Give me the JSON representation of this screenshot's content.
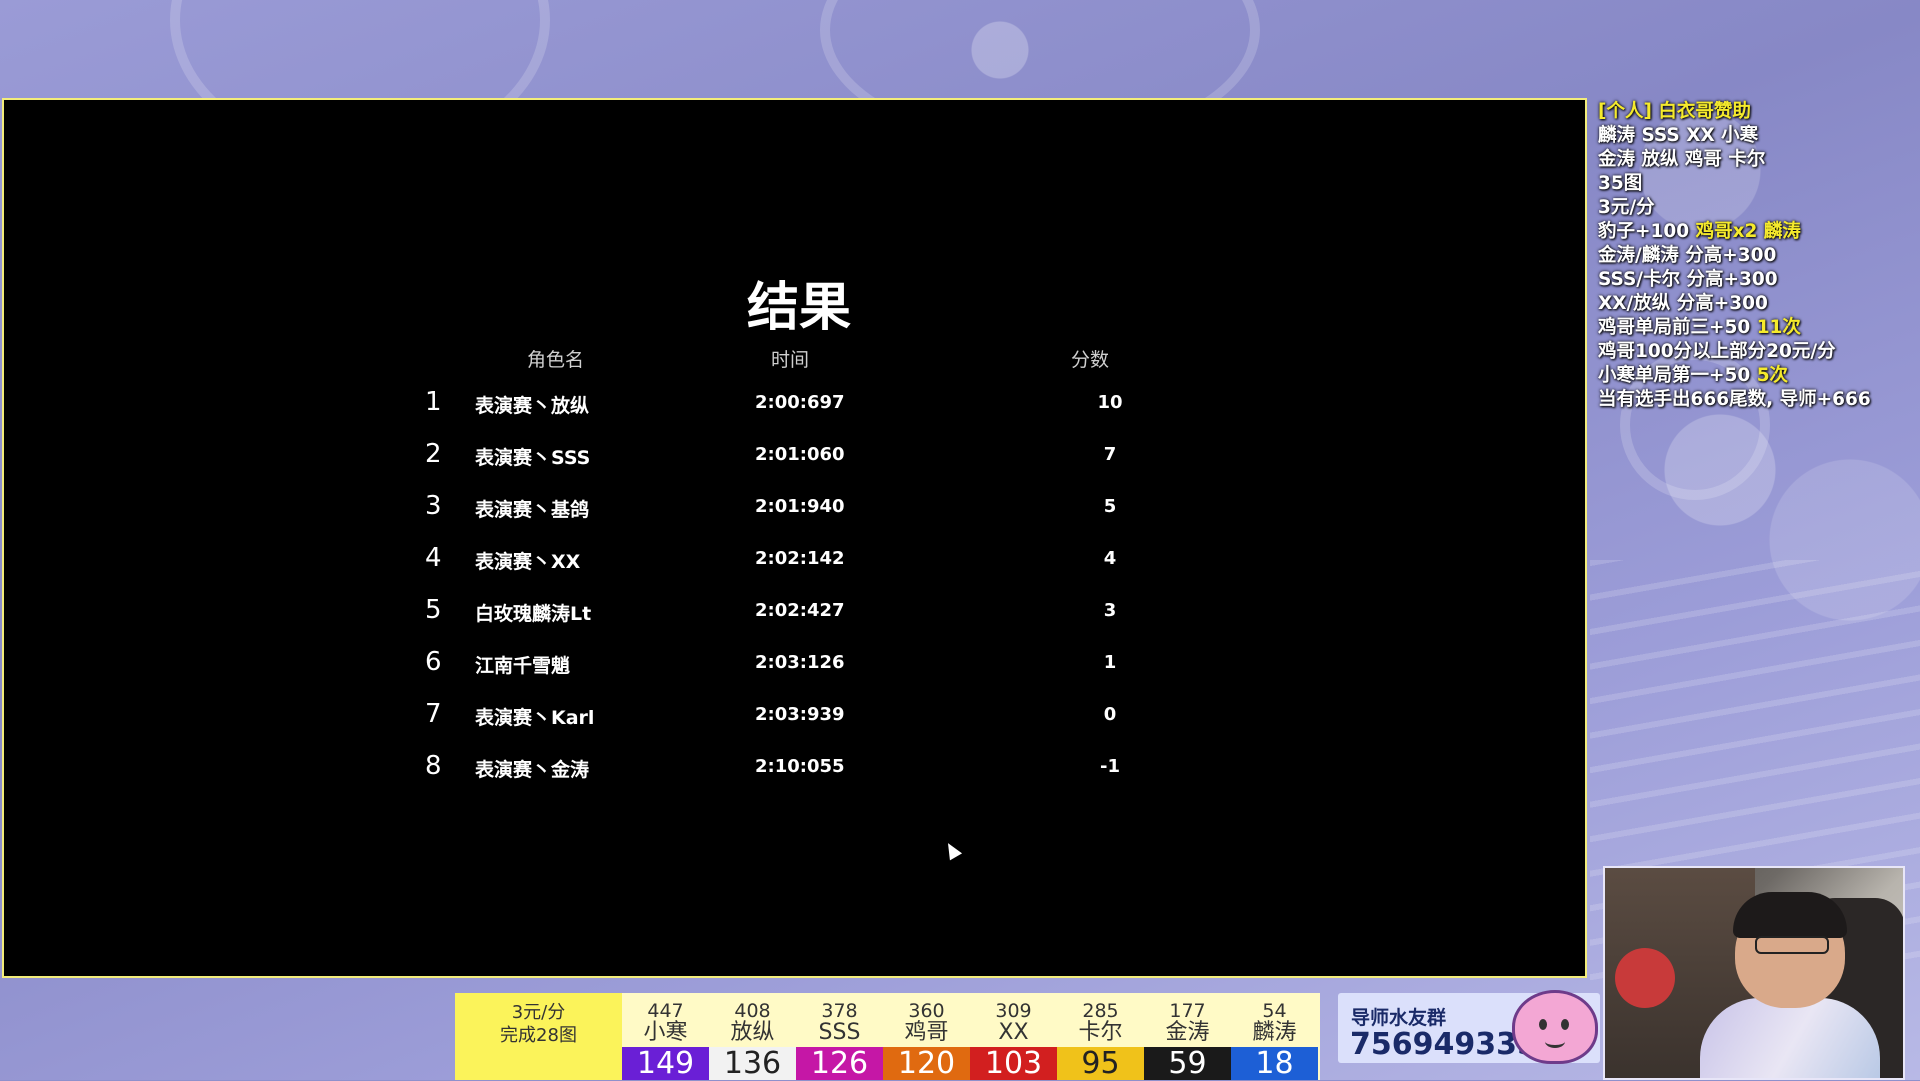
{
  "results": {
    "title": "结果",
    "headers": {
      "name": "角色名",
      "time": "时间",
      "score": "分数"
    },
    "rows": [
      {
        "rank": "1",
        "name": "表演赛丶放纵",
        "time": "2:00:697",
        "score": "10"
      },
      {
        "rank": "2",
        "name": "表演赛丶SSS",
        "time": "2:01:060",
        "score": "7"
      },
      {
        "rank": "3",
        "name": "表演赛丶基鸽",
        "time": "2:01:940",
        "score": "5"
      },
      {
        "rank": "4",
        "name": "表演赛丶XX",
        "time": "2:02:142",
        "score": "4"
      },
      {
        "rank": "5",
        "name": "白玫瑰麟涛Lt",
        "time": "2:02:427",
        "score": "3"
      },
      {
        "rank": "6",
        "name": "江南千雪魈",
        "time": "2:03:126",
        "score": "1"
      },
      {
        "rank": "7",
        "name": "表演赛丶Karl",
        "time": "2:03:939",
        "score": "0"
      },
      {
        "rank": "8",
        "name": "表演赛丶金涛",
        "time": "2:10:055",
        "score": "-1"
      }
    ]
  },
  "sponsor": {
    "lines": [
      {
        "parts": [
          {
            "text": "[个人] 白衣哥赞助",
            "hl": true
          }
        ]
      },
      {
        "parts": [
          {
            "text": "麟涛 SSS XX 小寒",
            "hl": false
          }
        ]
      },
      {
        "parts": [
          {
            "text": "金涛 放纵 鸡哥 卡尔",
            "hl": false
          }
        ]
      },
      {
        "parts": [
          {
            "text": "35图",
            "hl": false
          }
        ]
      },
      {
        "parts": [
          {
            "text": "3元/分",
            "hl": false
          }
        ]
      },
      {
        "parts": [
          {
            "text": "豹子+100 ",
            "hl": false
          },
          {
            "text": "鸡哥x2 麟涛",
            "hl": true
          }
        ]
      },
      {
        "parts": [
          {
            "text": "金涛/麟涛 分高+300",
            "hl": false
          }
        ]
      },
      {
        "parts": [
          {
            "text": "SSS/卡尔 分高+300",
            "hl": false
          }
        ]
      },
      {
        "parts": [
          {
            "text": "XX/放纵 分高+300",
            "hl": false
          }
        ]
      },
      {
        "parts": [
          {
            "text": "鸡哥单局前三+50 ",
            "hl": false
          },
          {
            "text": "11次",
            "hl": true
          }
        ]
      },
      {
        "parts": [
          {
            "text": "鸡哥100分以上部分20元/分",
            "hl": false
          }
        ]
      },
      {
        "parts": [
          {
            "text": "小寒单局第一+50 ",
            "hl": false
          },
          {
            "text": "5次",
            "hl": true
          }
        ]
      },
      {
        "parts": [
          {
            "text": "当有选手出666尾数, 导师+666",
            "hl": false
          }
        ]
      }
    ]
  },
  "scoreboard": {
    "info_line1": "3元/分",
    "info_line2": "完成28图",
    "players": [
      {
        "total": "447",
        "name": "小寒",
        "round": "149",
        "color": "#6a1fd6"
      },
      {
        "total": "408",
        "name": "放纵",
        "round": "136",
        "color": "#f2f2f2"
      },
      {
        "total": "378",
        "name": "SSS",
        "round": "126",
        "color": "#c517a6"
      },
      {
        "total": "360",
        "name": "鸡哥",
        "round": "120",
        "color": "#e06a10"
      },
      {
        "total": "309",
        "name": "XX",
        "round": "103",
        "color": "#d21f1f"
      },
      {
        "total": "285",
        "name": "卡尔",
        "round": "95",
        "color": "#f0c21a"
      },
      {
        "total": "177",
        "name": "金涛",
        "round": "59",
        "color": "#1a1a1a"
      },
      {
        "total": "54",
        "name": "麟涛",
        "round": "18",
        "color": "#1d5fd6"
      }
    ]
  },
  "qq_group": {
    "label": "导师水友群",
    "number": "756949335"
  }
}
